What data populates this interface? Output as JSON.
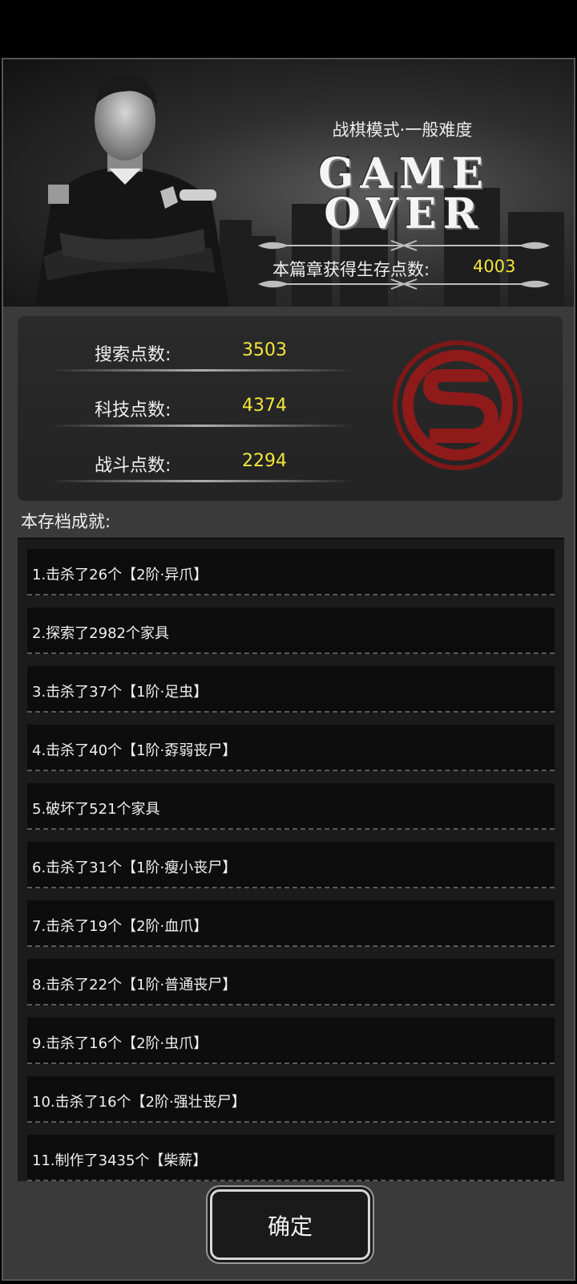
{
  "banner": {
    "mode_label": "战棋模式·一般难度",
    "game_over_line1": "GAME",
    "game_over_line2": "OVER",
    "survival_label": "本篇章获得生存点数:",
    "survival_value": "4003"
  },
  "points": [
    {
      "label": "搜索点数:",
      "value": "3503"
    },
    {
      "label": "科技点数:",
      "value": "4374"
    },
    {
      "label": "战斗点数:",
      "value": "2294"
    }
  ],
  "achievements_title": "本存档成就:",
  "achievements": [
    "1.击杀了26个【2阶·异爪】",
    "2.探索了2982个家具",
    "3.击杀了37个【1阶·足虫】",
    "4.击杀了40个【1阶·孬弱丧尸】",
    "5.破坏了521个家具",
    "6.击杀了31个【1阶·瘦小丧尸】",
    "7.击杀了19个【2阶·血爪】",
    "8.击杀了22个【1阶·普通丧尸】",
    "9.击杀了16个【2阶·虫爪】",
    "10.击杀了16个【2阶·强壮丧尸】",
    "11.制作了3435个【柴薪】"
  ],
  "confirm_label": "确定",
  "colors": {
    "accent_value": "#f3e73c",
    "logo_red": "#8e1a1a"
  },
  "icons": [
    "police-officer-portrait",
    "s-emblem-icon",
    "ornament-divider"
  ]
}
